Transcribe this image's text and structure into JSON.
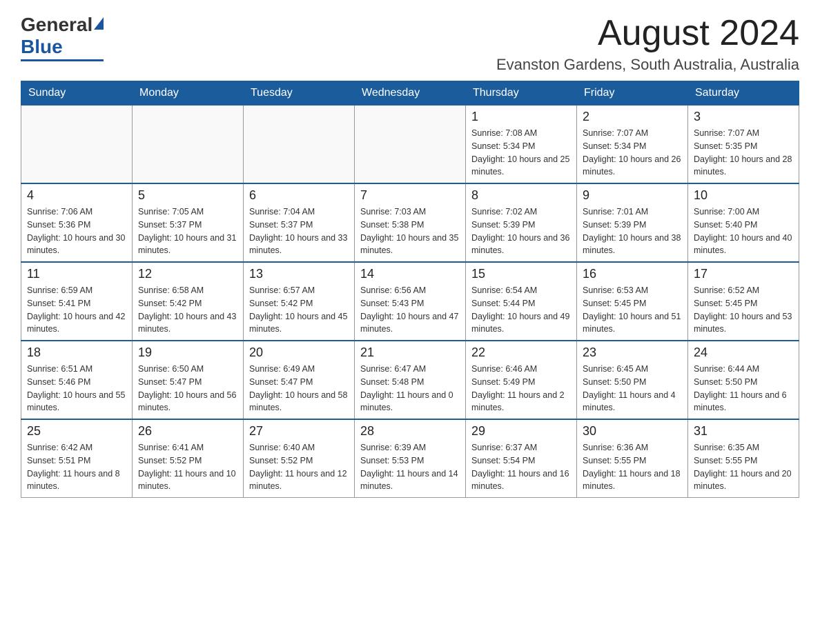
{
  "header": {
    "logo": {
      "general": "General",
      "blue": "Blue"
    },
    "month": "August 2024",
    "location": "Evanston Gardens, South Australia, Australia"
  },
  "days_of_week": [
    "Sunday",
    "Monday",
    "Tuesday",
    "Wednesday",
    "Thursday",
    "Friday",
    "Saturday"
  ],
  "weeks": [
    [
      {
        "day": "",
        "info": ""
      },
      {
        "day": "",
        "info": ""
      },
      {
        "day": "",
        "info": ""
      },
      {
        "day": "",
        "info": ""
      },
      {
        "day": "1",
        "info": "Sunrise: 7:08 AM\nSunset: 5:34 PM\nDaylight: 10 hours and 25 minutes."
      },
      {
        "day": "2",
        "info": "Sunrise: 7:07 AM\nSunset: 5:34 PM\nDaylight: 10 hours and 26 minutes."
      },
      {
        "day": "3",
        "info": "Sunrise: 7:07 AM\nSunset: 5:35 PM\nDaylight: 10 hours and 28 minutes."
      }
    ],
    [
      {
        "day": "4",
        "info": "Sunrise: 7:06 AM\nSunset: 5:36 PM\nDaylight: 10 hours and 30 minutes."
      },
      {
        "day": "5",
        "info": "Sunrise: 7:05 AM\nSunset: 5:37 PM\nDaylight: 10 hours and 31 minutes."
      },
      {
        "day": "6",
        "info": "Sunrise: 7:04 AM\nSunset: 5:37 PM\nDaylight: 10 hours and 33 minutes."
      },
      {
        "day": "7",
        "info": "Sunrise: 7:03 AM\nSunset: 5:38 PM\nDaylight: 10 hours and 35 minutes."
      },
      {
        "day": "8",
        "info": "Sunrise: 7:02 AM\nSunset: 5:39 PM\nDaylight: 10 hours and 36 minutes."
      },
      {
        "day": "9",
        "info": "Sunrise: 7:01 AM\nSunset: 5:39 PM\nDaylight: 10 hours and 38 minutes."
      },
      {
        "day": "10",
        "info": "Sunrise: 7:00 AM\nSunset: 5:40 PM\nDaylight: 10 hours and 40 minutes."
      }
    ],
    [
      {
        "day": "11",
        "info": "Sunrise: 6:59 AM\nSunset: 5:41 PM\nDaylight: 10 hours and 42 minutes."
      },
      {
        "day": "12",
        "info": "Sunrise: 6:58 AM\nSunset: 5:42 PM\nDaylight: 10 hours and 43 minutes."
      },
      {
        "day": "13",
        "info": "Sunrise: 6:57 AM\nSunset: 5:42 PM\nDaylight: 10 hours and 45 minutes."
      },
      {
        "day": "14",
        "info": "Sunrise: 6:56 AM\nSunset: 5:43 PM\nDaylight: 10 hours and 47 minutes."
      },
      {
        "day": "15",
        "info": "Sunrise: 6:54 AM\nSunset: 5:44 PM\nDaylight: 10 hours and 49 minutes."
      },
      {
        "day": "16",
        "info": "Sunrise: 6:53 AM\nSunset: 5:45 PM\nDaylight: 10 hours and 51 minutes."
      },
      {
        "day": "17",
        "info": "Sunrise: 6:52 AM\nSunset: 5:45 PM\nDaylight: 10 hours and 53 minutes."
      }
    ],
    [
      {
        "day": "18",
        "info": "Sunrise: 6:51 AM\nSunset: 5:46 PM\nDaylight: 10 hours and 55 minutes."
      },
      {
        "day": "19",
        "info": "Sunrise: 6:50 AM\nSunset: 5:47 PM\nDaylight: 10 hours and 56 minutes."
      },
      {
        "day": "20",
        "info": "Sunrise: 6:49 AM\nSunset: 5:47 PM\nDaylight: 10 hours and 58 minutes."
      },
      {
        "day": "21",
        "info": "Sunrise: 6:47 AM\nSunset: 5:48 PM\nDaylight: 11 hours and 0 minutes."
      },
      {
        "day": "22",
        "info": "Sunrise: 6:46 AM\nSunset: 5:49 PM\nDaylight: 11 hours and 2 minutes."
      },
      {
        "day": "23",
        "info": "Sunrise: 6:45 AM\nSunset: 5:50 PM\nDaylight: 11 hours and 4 minutes."
      },
      {
        "day": "24",
        "info": "Sunrise: 6:44 AM\nSunset: 5:50 PM\nDaylight: 11 hours and 6 minutes."
      }
    ],
    [
      {
        "day": "25",
        "info": "Sunrise: 6:42 AM\nSunset: 5:51 PM\nDaylight: 11 hours and 8 minutes."
      },
      {
        "day": "26",
        "info": "Sunrise: 6:41 AM\nSunset: 5:52 PM\nDaylight: 11 hours and 10 minutes."
      },
      {
        "day": "27",
        "info": "Sunrise: 6:40 AM\nSunset: 5:52 PM\nDaylight: 11 hours and 12 minutes."
      },
      {
        "day": "28",
        "info": "Sunrise: 6:39 AM\nSunset: 5:53 PM\nDaylight: 11 hours and 14 minutes."
      },
      {
        "day": "29",
        "info": "Sunrise: 6:37 AM\nSunset: 5:54 PM\nDaylight: 11 hours and 16 minutes."
      },
      {
        "day": "30",
        "info": "Sunrise: 6:36 AM\nSunset: 5:55 PM\nDaylight: 11 hours and 18 minutes."
      },
      {
        "day": "31",
        "info": "Sunrise: 6:35 AM\nSunset: 5:55 PM\nDaylight: 11 hours and 20 minutes."
      }
    ]
  ]
}
